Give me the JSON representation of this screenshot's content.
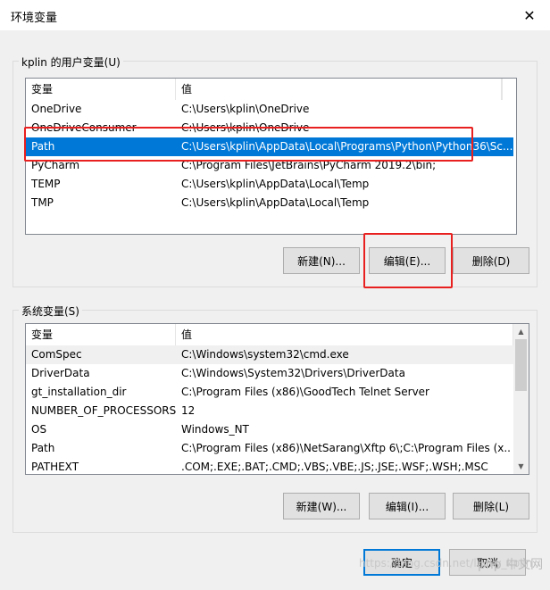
{
  "window": {
    "title": "环境变量",
    "close_glyph": "✕"
  },
  "user_vars": {
    "group_label": "kplin 的用户变量(U)",
    "col_variable": "变量",
    "col_value": "值",
    "rows": [
      {
        "name": "OneDrive",
        "value": "C:\\Users\\kplin\\OneDrive"
      },
      {
        "name": "OneDriveConsumer",
        "value": "C:\\Users\\kplin\\OneDrive"
      },
      {
        "name": "Path",
        "value": "C:\\Users\\kplin\\AppData\\Local\\Programs\\Python\\Python36\\Sc..."
      },
      {
        "name": "PyCharm",
        "value": "C:\\Program Files\\JetBrains\\PyCharm 2019.2\\bin;"
      },
      {
        "name": "TEMP",
        "value": "C:\\Users\\kplin\\AppData\\Local\\Temp"
      },
      {
        "name": "TMP",
        "value": "C:\\Users\\kplin\\AppData\\Local\\Temp"
      }
    ],
    "buttons": {
      "new": "新建(N)...",
      "edit": "编辑(E)...",
      "delete": "删除(D)"
    }
  },
  "system_vars": {
    "group_label": "系统变量(S)",
    "col_variable": "变量",
    "col_value": "值",
    "rows": [
      {
        "name": "ComSpec",
        "value": "C:\\Windows\\system32\\cmd.exe"
      },
      {
        "name": "DriverData",
        "value": "C:\\Windows\\System32\\Drivers\\DriverData"
      },
      {
        "name": "gt_installation_dir",
        "value": "C:\\Program Files (x86)\\GoodTech Telnet Server"
      },
      {
        "name": "NUMBER_OF_PROCESSORS",
        "value": "12"
      },
      {
        "name": "OS",
        "value": "Windows_NT"
      },
      {
        "name": "Path",
        "value": "C:\\Program Files (x86)\\NetSarang\\Xftp 6\\;C:\\Program Files (x..."
      },
      {
        "name": "PATHEXT",
        "value": ".COM;.EXE;.BAT;.CMD;.VBS;.VBE;.JS;.JSE;.WSF;.WSH;.MSC"
      }
    ],
    "buttons": {
      "new": "新建(W)...",
      "edit": "编辑(I)...",
      "delete": "删除(L)"
    }
  },
  "footer": {
    "ok": "确定",
    "cancel": "取消"
  },
  "watermark": {
    "url": "https://blog.csdn.net/lucky_kplin",
    "logo": "php 中文网"
  },
  "colors": {
    "selection": "#0078d7",
    "annotation": "#e8201f"
  }
}
